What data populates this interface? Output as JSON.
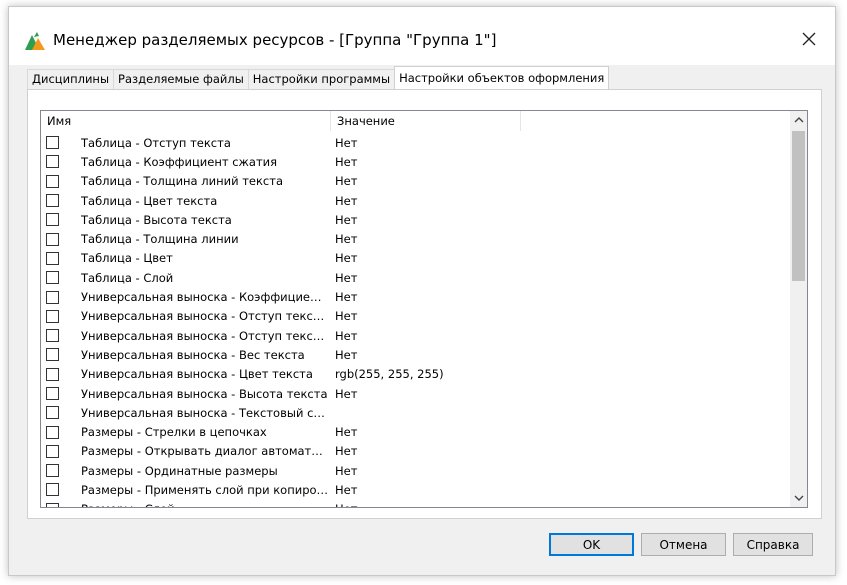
{
  "window": {
    "title": "Менеджер разделяемых ресурсов - [Группа \"Группа 1\"]"
  },
  "tabs": [
    {
      "label": "Дисциплины",
      "active": false
    },
    {
      "label": "Разделяемые файлы",
      "active": false
    },
    {
      "label": "Настройки программы",
      "active": false
    },
    {
      "label": "Настройки объектов оформления",
      "active": true
    }
  ],
  "list": {
    "columns": {
      "name": "Имя",
      "value": "Значение"
    },
    "rows": [
      {
        "name": "Таблица - Отступ текста",
        "value": "Нет"
      },
      {
        "name": "Таблица - Коэффициент сжатия",
        "value": "Нет"
      },
      {
        "name": "Таблица - Толщина линий текста",
        "value": "Нет"
      },
      {
        "name": "Таблица - Цвет текста",
        "value": "Нет"
      },
      {
        "name": "Таблица - Высота текста",
        "value": "Нет"
      },
      {
        "name": "Таблица - Толщина линии",
        "value": "Нет"
      },
      {
        "name": "Таблица - Цвет",
        "value": "Нет"
      },
      {
        "name": "Таблица - Слой",
        "value": "Нет"
      },
      {
        "name": "Универсальная выноска - Коэффициент ...",
        "value": "Нет"
      },
      {
        "name": "Универсальная выноска - Отступ текста ...",
        "value": "Нет"
      },
      {
        "name": "Универсальная выноска - Отступ текста ...",
        "value": "Нет"
      },
      {
        "name": "Универсальная выноска - Вес текста",
        "value": "Нет"
      },
      {
        "name": "Универсальная выноска - Цвет текста",
        "value": "rgb(255, 255, 255)"
      },
      {
        "name": "Универсальная выноска - Высота текста",
        "value": "Нет"
      },
      {
        "name": "Универсальная выноска - Текстовый стиль",
        "value": ""
      },
      {
        "name": "Размеры - Стрелки в цепочках",
        "value": "Нет"
      },
      {
        "name": "Размеры - Открывать диалог автоматиче...",
        "value": "Нет"
      },
      {
        "name": "Размеры - Ординатные размеры",
        "value": "Нет"
      },
      {
        "name": "Размеры - Применять слой при копирова...",
        "value": "Нет"
      },
      {
        "name": "Размеры - Слой",
        "value": "Нет"
      }
    ]
  },
  "buttons": {
    "ok": "OK",
    "cancel": "Отмена",
    "help": "Справка"
  },
  "colors": {
    "accent": "#0078d7",
    "logo_green": "#2e9e4f",
    "logo_orange": "#f39a1e"
  }
}
